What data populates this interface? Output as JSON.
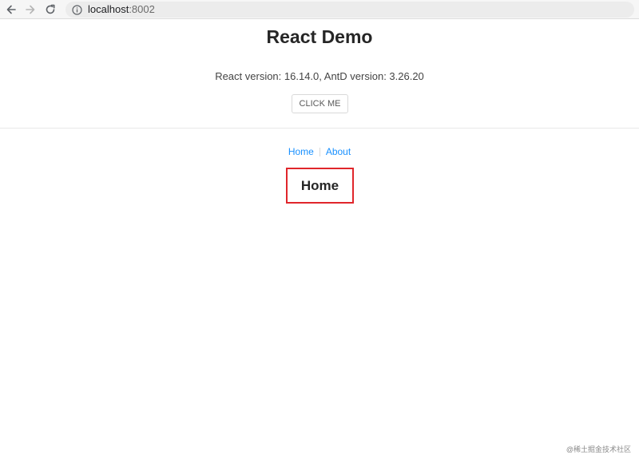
{
  "browser": {
    "url_host": "localhost",
    "url_port": ":8002"
  },
  "app": {
    "title": "React Demo",
    "version_text": "React version: 16.14.0, AntD version: 3.26.20",
    "click_button_label": "CLICK ME"
  },
  "nav": {
    "links": [
      {
        "label": "Home"
      },
      {
        "label": "About"
      }
    ]
  },
  "route": {
    "heading": "Home"
  },
  "watermark": {
    "text": "@稀土掘金技术社区"
  },
  "colors": {
    "link": "#1890ff",
    "highlight_box": "#e0262b"
  }
}
